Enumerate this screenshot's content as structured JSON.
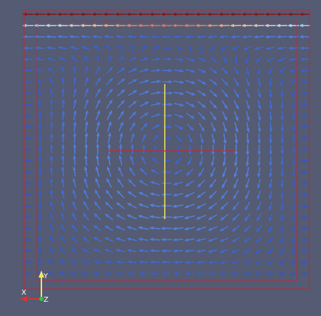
{
  "viewport": {
    "background_color": "#545b72",
    "domain_box_color": "#c0283c",
    "probe_line_vertical_color": "#f2e85a",
    "probe_line_horizontal_color": "#c0283c"
  },
  "vector_field": {
    "description_type": "lid-driven-cavity glyphs",
    "grid_columns": 25,
    "grid_rows": 25,
    "colormap": [
      "#2a3a9a",
      "#3a62d0",
      "#6a9ae8",
      "#bcd6f2",
      "#f0b48a",
      "#c03030",
      "#7a1010"
    ]
  },
  "orientation_axes": {
    "x_label": "X",
    "y_label": "Y",
    "z_label": "Z",
    "x_color": "#e03030",
    "y_color": "#f2e85a",
    "z_color": "#3ac040"
  }
}
